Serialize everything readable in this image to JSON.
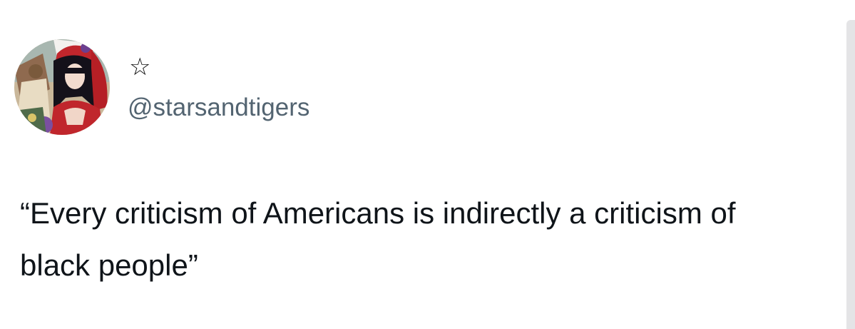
{
  "user": {
    "display_name": "☆",
    "handle": "@starsandtigers",
    "avatar_icon": "anime-character-avatar"
  },
  "tweet": {
    "text": "“Every criticism of Americans is indirectly a criticism of black people”"
  },
  "colors": {
    "text": "#0f1419",
    "handle": "#536471",
    "background": "#ffffff",
    "scrollbar": "#e4e4e6"
  }
}
